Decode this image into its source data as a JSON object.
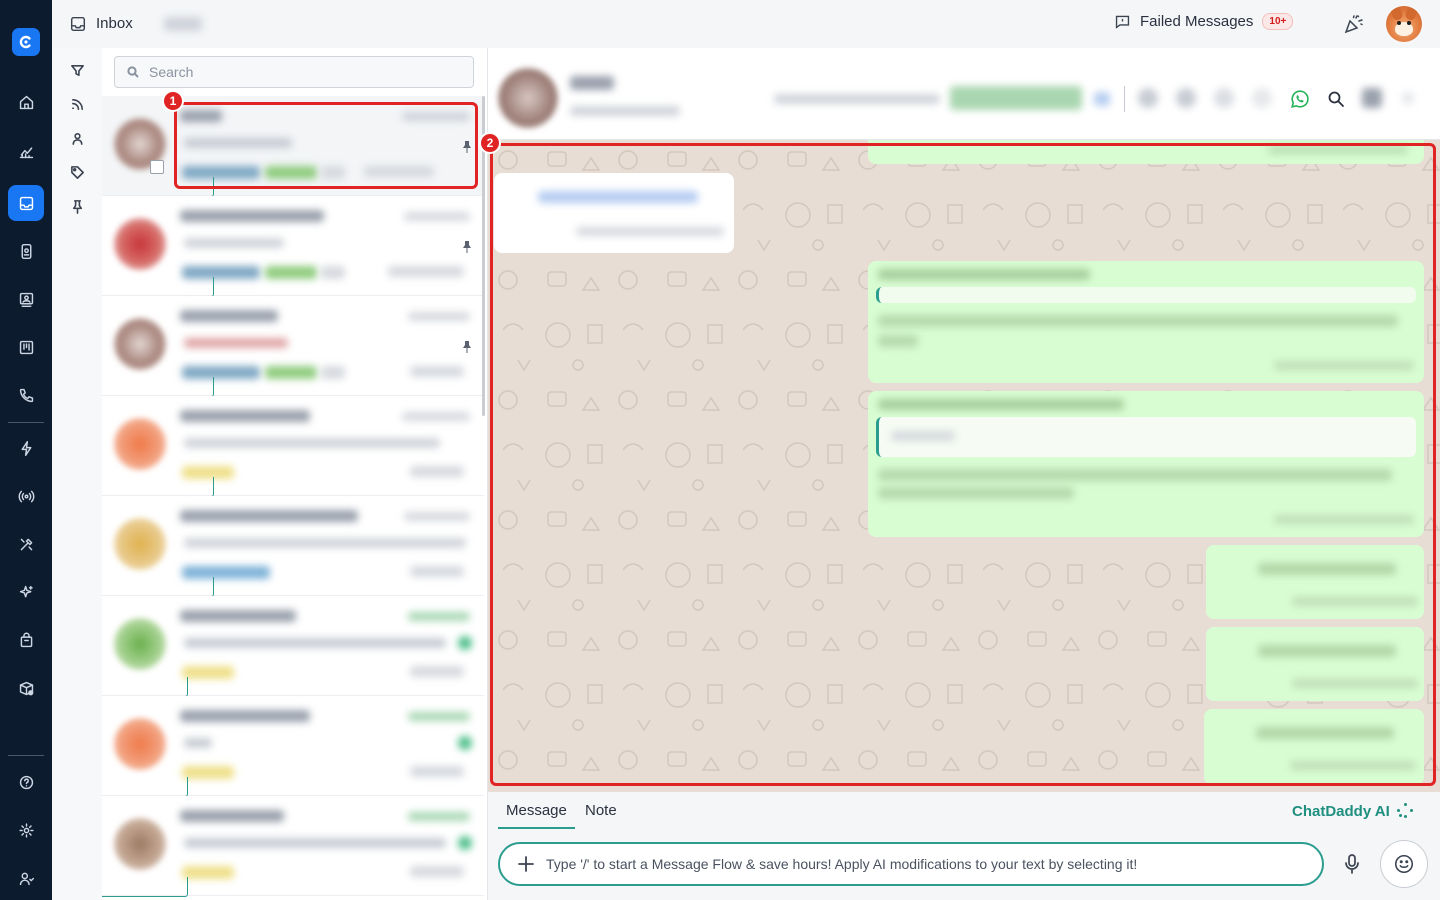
{
  "topbar": {
    "inbox_label": "Inbox",
    "failed_label": "Failed Messages",
    "failed_badge": "10+"
  },
  "list": {
    "search_placeholder": "Search"
  },
  "markers": {
    "one": "1",
    "two": "2"
  },
  "composer": {
    "tab_message": "Message",
    "tab_note": "Note",
    "ai_label": "ChatDaddy AI",
    "input_placeholder": "Type '/' to start a Message Flow & save hours! Apply AI modifications to your text by selecting it!"
  },
  "colors": {
    "accent": "#2a9d8f",
    "brand": "#1977f3",
    "rail": "#0d1b2e",
    "marker": "#e02424",
    "bubble_out": "#d9fdd3",
    "chat_bg": "#e7ddd4"
  },
  "icons": {
    "rail": [
      "home-icon",
      "analytics-icon",
      "inbox-icon",
      "contacts-card-icon",
      "campaigns-icon",
      "kanban-icon",
      "phone-icon",
      "automation-icon",
      "broadcast-icon",
      "tools-icon",
      "ai-sparkle-icon",
      "shop-icon",
      "package-icon",
      "help-icon",
      "settings-icon",
      "team-icon"
    ],
    "filters": [
      "filter-icon",
      "feed-icon",
      "assignee-icon",
      "tag-icon",
      "pin-icon"
    ],
    "chat_header": [
      "whatsapp-icon",
      "search-icon"
    ]
  }
}
